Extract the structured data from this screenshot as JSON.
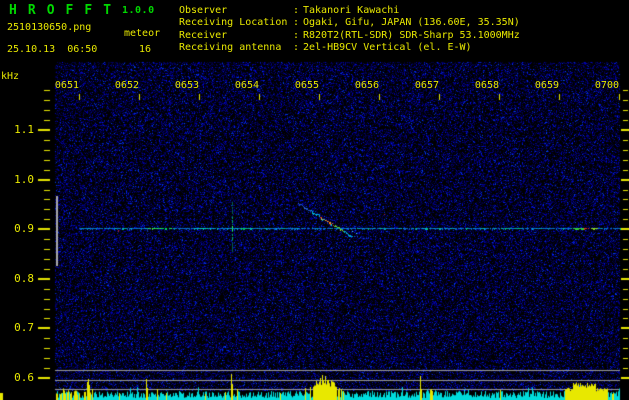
{
  "app": {
    "name": "HROFFT",
    "title": "H R O F F T",
    "version": "1.0.0"
  },
  "capture": {
    "filename": "2510130650.png",
    "mode": "meteor",
    "datetime": "25.10.13  06:50",
    "echo_count": "16"
  },
  "station": {
    "separator": ":",
    "rows": [
      {
        "label": "Observer",
        "value": "Takanori Kawachi"
      },
      {
        "label": "Receiving Location",
        "value": "Ogaki, Gifu, JAPAN (136.60E, 35.35N)"
      },
      {
        "label": "Receiver",
        "value": "R820T2(RTL-SDR) SDR-Sharp 53.1000MHz"
      },
      {
        "label": "Receiving antenna",
        "value": "2el-HB9CV Vertical (el. E-W)"
      }
    ]
  },
  "chart_data": {
    "type": "heatmap",
    "subtype": "radio-meteor-spectrogram",
    "title": "",
    "ylabel": "kHz",
    "xlabel": "time HHMM (0650-0700, 1-min ticks)",
    "y_tick_labels": [
      "1.1",
      "1.0",
      "0.9",
      "0.8",
      "0.7",
      "0.6"
    ],
    "x_tick_labels": [
      "0651",
      "0652",
      "0653",
      "0654",
      "0655",
      "0656",
      "0657",
      "0658",
      "0659",
      "0700"
    ],
    "y_range_khz": [
      0.58,
      1.24
    ],
    "grid": false,
    "legend": "none",
    "carrier_line_khz": 0.9,
    "events": [
      {
        "time": "~0653:30",
        "type": "underdense meteor echo",
        "shape": "vertical streak",
        "freq_khz": 0.9
      },
      {
        "time": "~0654:50-0655:30",
        "type": "meteor head echo with doppler drift",
        "shape": "diagonal trail",
        "freq_khz_from": 0.95,
        "freq_khz_to": 0.885
      },
      {
        "time": "~0659:15-0659:40",
        "type": "strong echo on carrier",
        "shape": "bright line segment",
        "freq_khz": 0.9
      }
    ],
    "level_meter": {
      "description": "received signal level strip at bottom",
      "baseline_color_name": "cyan",
      "spike_color_name": "yellow",
      "spike_times": [
        "0650:40-0651:30",
        "0652:07",
        "0653:32",
        "0654:45-0655:25",
        "0656:41",
        "0659:05-0659:50"
      ]
    }
  },
  "colors": {
    "background": "#000000",
    "text_yellow": "#e8e800",
    "title_green": "#00d800",
    "noise_blue": "#0028c8",
    "carrier_blue_cyan": "#0082d2",
    "echo_green": "#00dc64",
    "echo_red": "#dc3220",
    "level_bar_cyan": "#00dcdc",
    "reference_line_gray": "#9a9a9a",
    "marker_bar_gray": "#aaaaaa"
  }
}
